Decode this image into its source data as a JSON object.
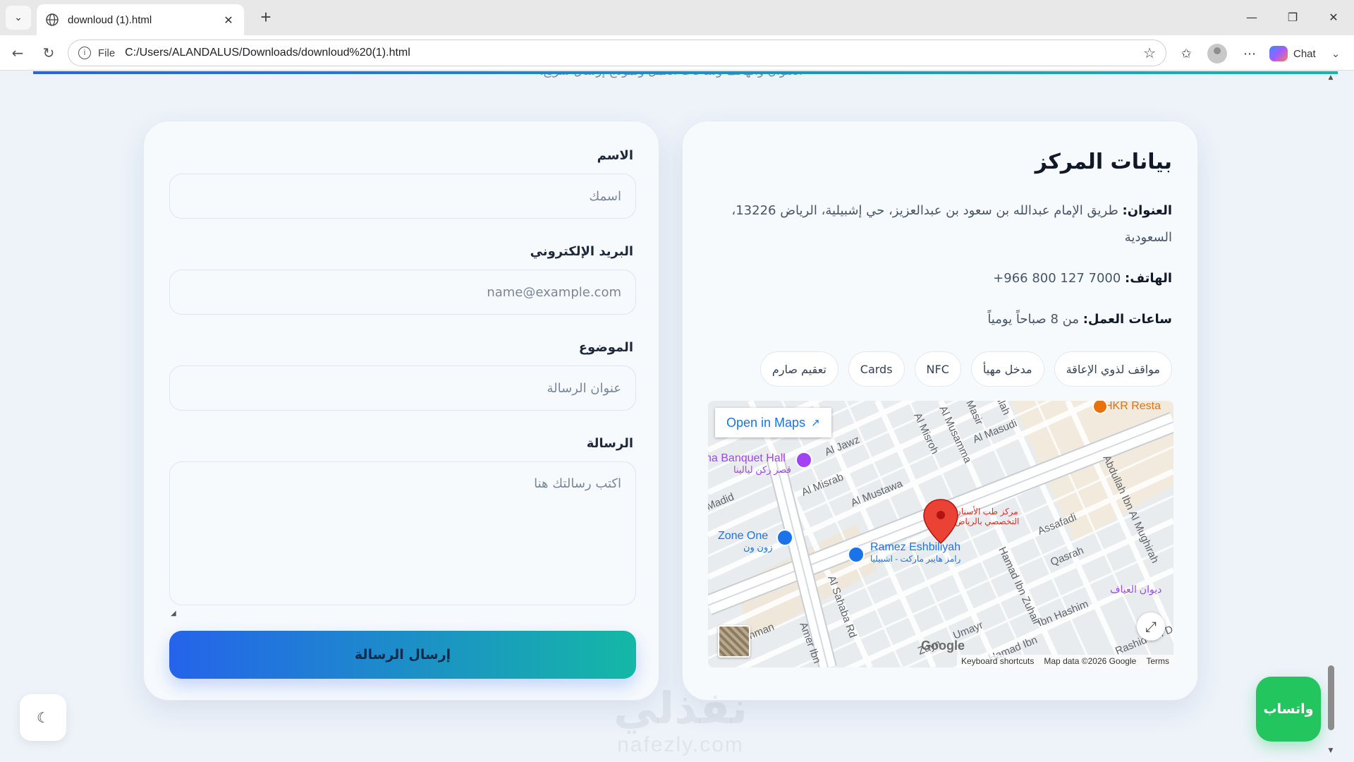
{
  "browser": {
    "tab_title": "downloud (1).html",
    "url_scheme": "File",
    "url": "C:/Users/ALANDALUS/Downloads/downloud%20(1).html",
    "chat_label": "Chat"
  },
  "page": {
    "cut_subtitle": "العنوان والهاتف وساعات العمل ونموذج إرسال سريع."
  },
  "form": {
    "name_label": "الاسم",
    "name_placeholder": "اسمك",
    "email_label": "البريد الإلكتروني",
    "email_placeholder": "name@example.com",
    "subject_label": "الموضوع",
    "subject_placeholder": "عنوان الرسالة",
    "message_label": "الرسالة",
    "message_placeholder": "اكتب رسالتك هنا",
    "submit_label": "إرسال الرسالة"
  },
  "info": {
    "title": "بيانات المركز",
    "address_label": "العنوان:",
    "address_value": "طريق الإمام عبدالله بن سعود بن عبدالعزيز، حي إشبيلية، الرياض 13226، السعودية",
    "phone_label": "الهاتف:",
    "phone_value": "+966 800 127 7000",
    "hours_label": "ساعات العمل:",
    "hours_value": "من 8 صباحاً يومياً",
    "chips": [
      "مواقف لذوي الإعاقة",
      "مدخل مهيأ",
      "NFC",
      "Cards",
      "تعقيم صارم"
    ]
  },
  "map": {
    "open_label": "Open in Maps",
    "labels": {
      "banquet": "na Banquet Hall",
      "banquet_ar": "قصر ركن ليالينا",
      "zone_one": "Zone One",
      "zone_one_ar": "زون ون",
      "ramez": "Ramez Eshbiliyah",
      "ramez_ar": "رامز هايبر ماركت - اشبيليا",
      "clinic_ar_1": "مركز طب الأسنان",
      "clinic_ar_2": "التخصصي بالرياض",
      "hkr": "HKR Resta",
      "diwan_ar": "ديوان العياف",
      "al_jawz": "Al Jawz",
      "al_misrab": "Al Misrab",
      "al_mustawa": "Al Mustawa",
      "al_misroh": "Al Misroh",
      "al_musamma": "Al Musamma",
      "al_masudi": "Al Masudi",
      "masir": "Masir",
      "llah": "llah",
      "madid": "Madid",
      "assafadi": "Assafadi",
      "qasrah": "Qasrah",
      "abdullah_ibn": "Abdullah Ibn Al Mughirah",
      "hamad_ibn": "Hamad Ibn Zuhair",
      "al_sahaba": "Al Sahaba Rd",
      "amer_ibn": "Amer Ibn",
      "hman": "hman",
      "umayr": "Umayr",
      "zayn": "Zayn",
      "ibn_hashim": "Ibn Hashim",
      "amad_ibn": "Hamad Ibn",
      "rashid": "Rashid Ibn D"
    },
    "google": "Google",
    "footer_shortcuts": "Keyboard shortcuts",
    "footer_data": "Map data ©2026 Google",
    "footer_terms": "Terms"
  },
  "floating": {
    "whatsapp_label": "واتساب",
    "theme_icon": "☾",
    "watermark_ar": "نفذلي",
    "watermark_en": "nafezly.com"
  },
  "colors": {
    "accent_gradient_start": "#2563eb",
    "accent_gradient_end": "#14b8a6",
    "whatsapp": "#22c55e",
    "map_pin": "#ea4335"
  }
}
